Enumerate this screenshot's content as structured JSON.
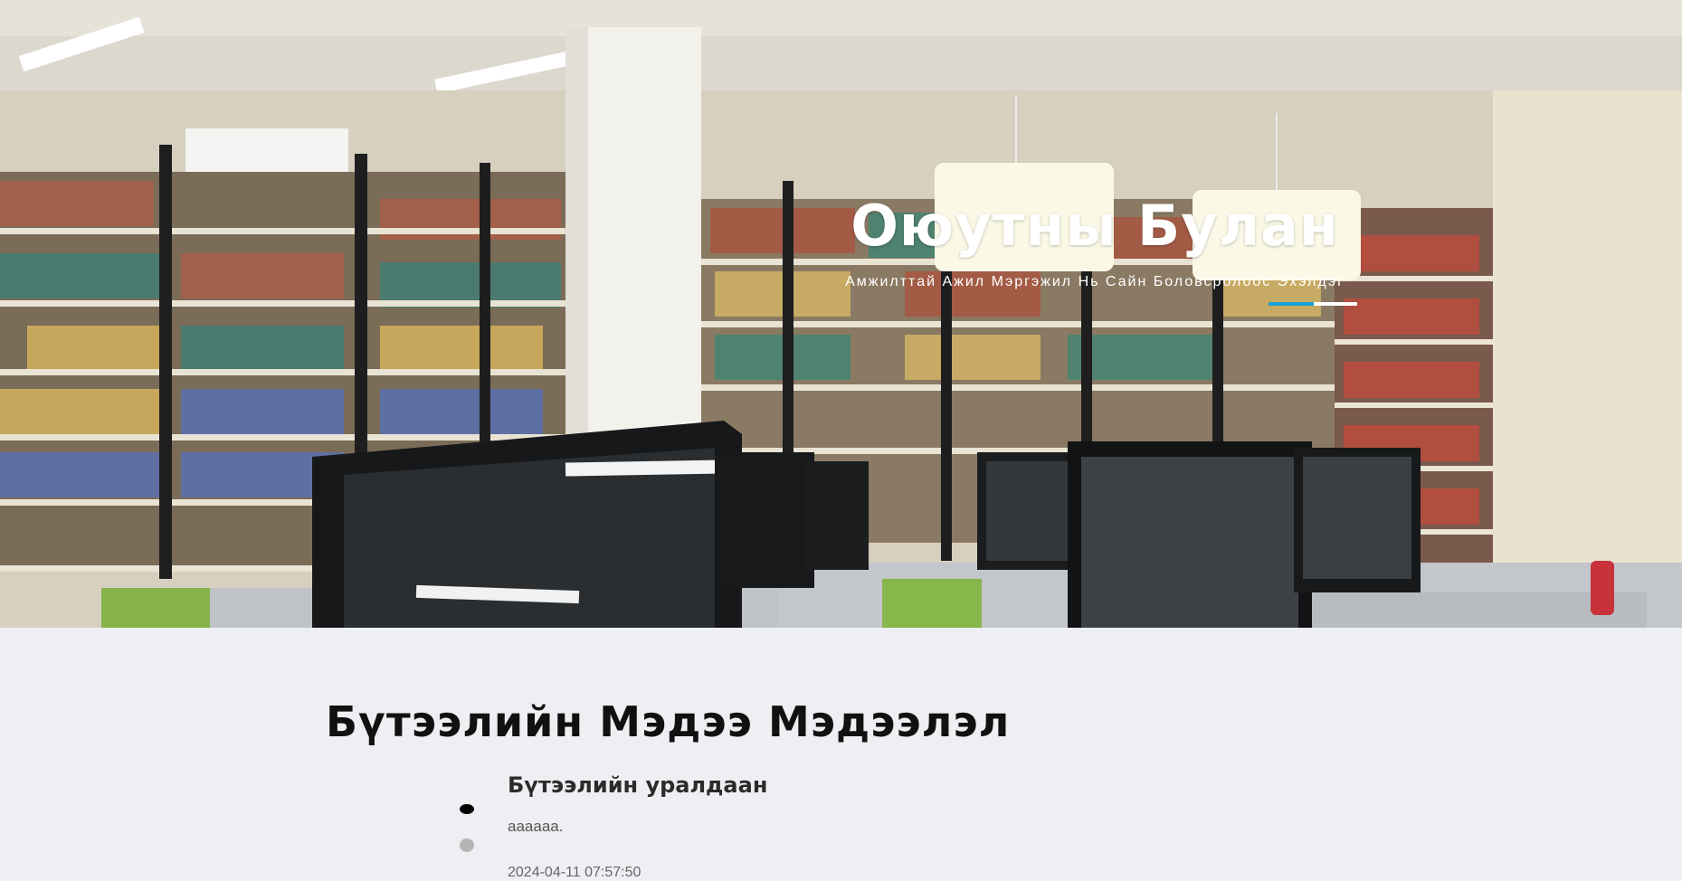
{
  "hero": {
    "title": "Оюутны Булан",
    "subtitle": "Амжилттай Ажил Мэргэжил Нь Сайн Боловсролоос Эхэлдэг",
    "image_alt": "library-photo",
    "accent_color": "#1aa0d8"
  },
  "section": {
    "title": "Бүтээлийн Мэдээ Мэдээлэл"
  },
  "news": [
    {
      "title": "Бүтээлийн уралдаан",
      "body": "аааааа.",
      "date": "2024-04-11 07:57:50"
    }
  ]
}
